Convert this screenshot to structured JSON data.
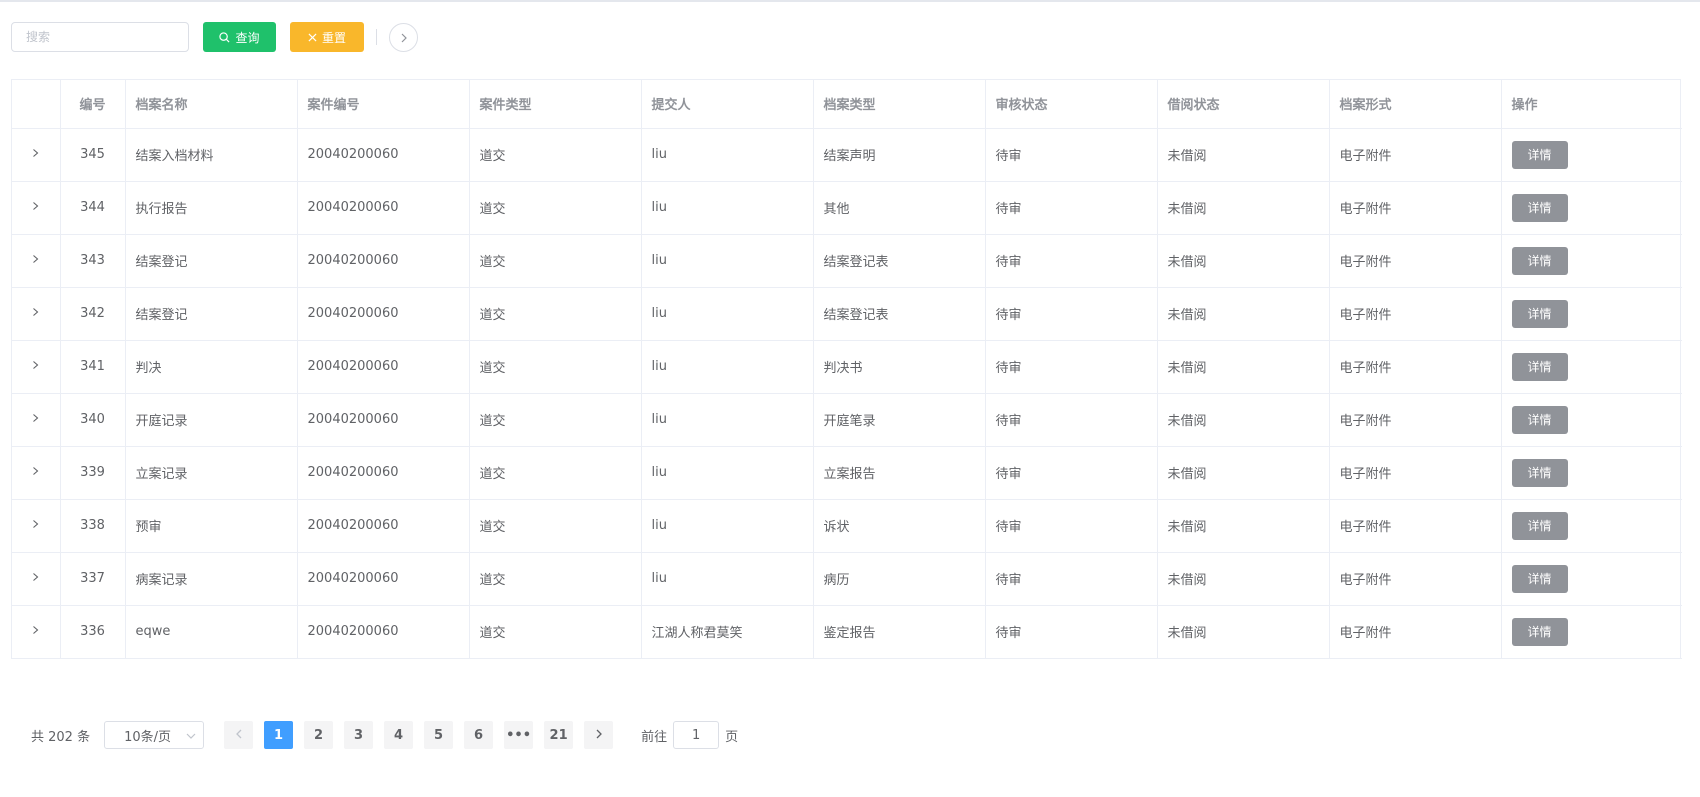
{
  "toolbar": {
    "search_placeholder": "搜索",
    "query_label": "查询",
    "reset_label": "重置"
  },
  "table": {
    "headers": [
      "",
      "编号",
      "档案名称",
      "案件编号",
      "案件类型",
      "提交人",
      "档案类型",
      "审核状态",
      "借阅状态",
      "档案形式",
      "操作"
    ],
    "action_label": "详情",
    "rows": [
      {
        "id": "345",
        "name": "结案入档材料",
        "case_no": "20040200060",
        "case_type": "道交",
        "submitter": "liu",
        "file_type": "结案声明",
        "review": "待审",
        "borrow": "未借阅",
        "form": "电子附件"
      },
      {
        "id": "344",
        "name": "执行报告",
        "case_no": "20040200060",
        "case_type": "道交",
        "submitter": "liu",
        "file_type": "其他",
        "review": "待审",
        "borrow": "未借阅",
        "form": "电子附件"
      },
      {
        "id": "343",
        "name": "结案登记",
        "case_no": "20040200060",
        "case_type": "道交",
        "submitter": "liu",
        "file_type": "结案登记表",
        "review": "待审",
        "borrow": "未借阅",
        "form": "电子附件"
      },
      {
        "id": "342",
        "name": "结案登记",
        "case_no": "20040200060",
        "case_type": "道交",
        "submitter": "liu",
        "file_type": "结案登记表",
        "review": "待审",
        "borrow": "未借阅",
        "form": "电子附件"
      },
      {
        "id": "341",
        "name": "判决",
        "case_no": "20040200060",
        "case_type": "道交",
        "submitter": "liu",
        "file_type": "判决书",
        "review": "待审",
        "borrow": "未借阅",
        "form": "电子附件"
      },
      {
        "id": "340",
        "name": "开庭记录",
        "case_no": "20040200060",
        "case_type": "道交",
        "submitter": "liu",
        "file_type": "开庭笔录",
        "review": "待审",
        "borrow": "未借阅",
        "form": "电子附件"
      },
      {
        "id": "339",
        "name": "立案记录",
        "case_no": "20040200060",
        "case_type": "道交",
        "submitter": "liu",
        "file_type": "立案报告",
        "review": "待审",
        "borrow": "未借阅",
        "form": "电子附件"
      },
      {
        "id": "338",
        "name": "预审",
        "case_no": "20040200060",
        "case_type": "道交",
        "submitter": "liu",
        "file_type": "诉状",
        "review": "待审",
        "borrow": "未借阅",
        "form": "电子附件"
      },
      {
        "id": "337",
        "name": "病案记录",
        "case_no": "20040200060",
        "case_type": "道交",
        "submitter": "liu",
        "file_type": "病历",
        "review": "待审",
        "borrow": "未借阅",
        "form": "电子附件"
      },
      {
        "id": "336",
        "name": "eqwe",
        "case_no": "20040200060",
        "case_type": "道交",
        "submitter": "江湖人称君莫笑",
        "file_type": "鉴定报告",
        "review": "待审",
        "borrow": "未借阅",
        "form": "电子附件"
      }
    ]
  },
  "pagination": {
    "total_text": "共 202 条",
    "page_size": "10条/页",
    "pages": [
      "1",
      "2",
      "3",
      "4",
      "5",
      "6",
      "•••",
      "21"
    ],
    "current": "1",
    "goto_prefix": "前往",
    "goto_value": "1",
    "goto_suffix": "页"
  },
  "colors": {
    "query": "#1fc16b",
    "reset": "#f9b72b",
    "active_page": "#409eff",
    "detail_button": "#909399"
  },
  "icons": {
    "query": "search-icon",
    "reset": "close-icon",
    "circle": "chevron-right-icon",
    "expand": "chevron-right-icon"
  }
}
